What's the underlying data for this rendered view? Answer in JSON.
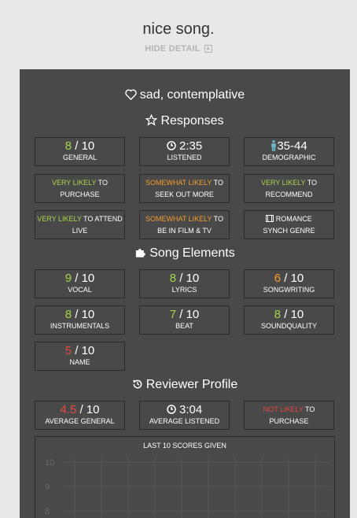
{
  "song": {
    "title": "nice song.",
    "hide_detail": "HIDE DETAIL"
  },
  "mood": {
    "label": "sad, contemplative"
  },
  "responses": {
    "title": "Responses",
    "general": {
      "score": "8",
      "max": "/ 10",
      "label": "GENERAL"
    },
    "listened": {
      "value": "2:35",
      "label": "LISTENED"
    },
    "demographic": {
      "value": "35-44",
      "label": "DEMOGRAPHIC"
    },
    "purchase": {
      "likely": "VERY LIKELY",
      "to": "TO",
      "rest": "PURCHASE"
    },
    "seek": {
      "likely": "SOMEWHAT LIKELY",
      "to": "TO",
      "rest": "SEEK OUT MORE"
    },
    "recommend": {
      "likely": "VERY LIKELY",
      "to": "TO",
      "rest": "RECOMMEND"
    },
    "attend": {
      "likely": "VERY LIKELY",
      "to": "TO ATTEND",
      "rest": "LIVE"
    },
    "film": {
      "likely": "SOMEWHAT LIKELY",
      "to": "TO",
      "rest": "BE IN FILM & TV"
    },
    "synch": {
      "genre": "ROMANCE",
      "rest": "SYNCH GENRE"
    }
  },
  "song_elements": {
    "title": "Song Elements",
    "items": [
      {
        "score": "9",
        "max": "/ 10",
        "label": "VOCAL",
        "color": "#a8d64b"
      },
      {
        "score": "8",
        "max": "/ 10",
        "label": "LYRICS",
        "color": "#a8d64b"
      },
      {
        "score": "6",
        "max": "/ 10",
        "label": "SONGWRITING",
        "color": "#f39c2e"
      },
      {
        "score": "8",
        "max": "/ 10",
        "label": "INSTRUMENTALS",
        "color": "#a8d64b"
      },
      {
        "score": "7",
        "max": "/ 10",
        "label": "BEAT",
        "color": "#a8d64b"
      },
      {
        "score": "8",
        "max": "/ 10",
        "label": "SOUNDQUALITY",
        "color": "#a8d64b"
      },
      {
        "score": "5",
        "max": "/ 10",
        "label": "NAME",
        "color": "#e8493f"
      }
    ]
  },
  "reviewer": {
    "title": "Reviewer Profile",
    "avg_general": {
      "score": "4.5",
      "max": "/ 10",
      "label": "AVERAGE GENERAL"
    },
    "avg_listened": {
      "value": "3:04",
      "label": "AVERAGE LISTENED"
    },
    "purchase": {
      "likely": "NOT LIKELY",
      "to": "TO",
      "rest": "PURCHASE"
    }
  },
  "chart_data": {
    "type": "line",
    "title": "LAST 10 SCORES GIVEN",
    "yticks": [
      "10",
      "9",
      "8"
    ],
    "ylim": [
      8,
      10
    ]
  },
  "colors": {
    "green": "#a8d64b",
    "orange": "#f39c2e",
    "red": "#e8493f",
    "teal": "#6ab8c6",
    "panel": "#494949"
  }
}
